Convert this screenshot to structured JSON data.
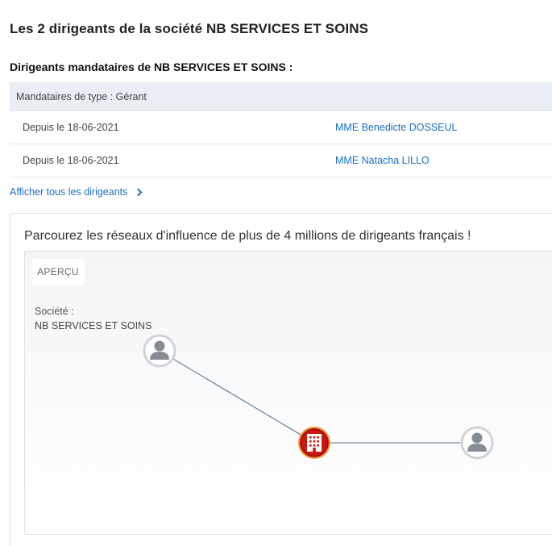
{
  "header": {
    "title": "Les 2 dirigeants de la société NB SERVICES ET SOINS",
    "section_title": "Dirigeants mandataires de NB SERVICES ET SOINS :"
  },
  "table": {
    "group_label": "Mandataires de type : Gérant",
    "rows": [
      {
        "since": "Depuis le 18-06-2021",
        "name": "MME Benedicte DOSSEUL"
      },
      {
        "since": "Depuis le 18-06-2021",
        "name": "MME Natacha LILLO"
      }
    ]
  },
  "show_all": {
    "label": "Afficher tous les dirigeants",
    "icon": "chevron-right-icon"
  },
  "network_card": {
    "title": "Parcourez les réseaux d'influence de plus de 4 millions de dirigeants français !",
    "preview_label": "APERÇU",
    "company_label": "Société :",
    "company_name": "NB SERVICES ET SOINS",
    "nodes": [
      {
        "type": "person",
        "icon": "person-icon"
      },
      {
        "type": "company",
        "icon": "building-icon",
        "color": "#c8180f"
      },
      {
        "type": "person",
        "icon": "person-icon"
      }
    ],
    "colors": {
      "edge": "#4d6c86",
      "node_ring": "#cfd3d8",
      "person": "#868c93"
    }
  },
  "colors": {
    "link": "#1a6fc4",
    "table_header_bg": "#e9eef5"
  }
}
